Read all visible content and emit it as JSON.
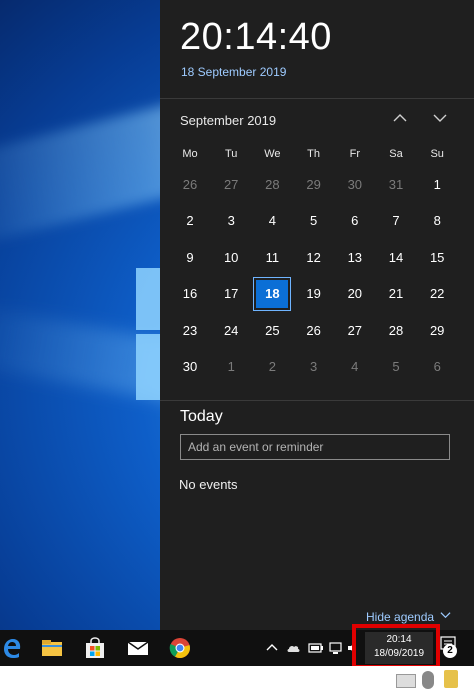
{
  "clock": {
    "time": "20:14:40",
    "date": "18 September 2019"
  },
  "calendar": {
    "month_label": "September 2019",
    "weekdays": [
      "Mo",
      "Tu",
      "We",
      "Th",
      "Fr",
      "Sa",
      "Su"
    ],
    "weeks": [
      [
        {
          "d": "26",
          "muted": true
        },
        {
          "d": "27",
          "muted": true
        },
        {
          "d": "28",
          "muted": true
        },
        {
          "d": "29",
          "muted": true
        },
        {
          "d": "30",
          "muted": true
        },
        {
          "d": "31",
          "muted": true
        },
        {
          "d": "1",
          "muted": false
        }
      ],
      [
        {
          "d": "2",
          "muted": false
        },
        {
          "d": "3",
          "muted": false
        },
        {
          "d": "4",
          "muted": false
        },
        {
          "d": "5",
          "muted": false
        },
        {
          "d": "6",
          "muted": false
        },
        {
          "d": "7",
          "muted": false
        },
        {
          "d": "8",
          "muted": false
        }
      ],
      [
        {
          "d": "9",
          "muted": false
        },
        {
          "d": "10",
          "muted": false
        },
        {
          "d": "11",
          "muted": false
        },
        {
          "d": "12",
          "muted": false
        },
        {
          "d": "13",
          "muted": false
        },
        {
          "d": "14",
          "muted": false
        },
        {
          "d": "15",
          "muted": false
        }
      ],
      [
        {
          "d": "16",
          "muted": false
        },
        {
          "d": "17",
          "muted": false
        },
        {
          "d": "18",
          "muted": false,
          "today": true
        },
        {
          "d": "19",
          "muted": false
        },
        {
          "d": "20",
          "muted": false
        },
        {
          "d": "21",
          "muted": false
        },
        {
          "d": "22",
          "muted": false
        }
      ],
      [
        {
          "d": "23",
          "muted": false
        },
        {
          "d": "24",
          "muted": false
        },
        {
          "d": "25",
          "muted": false
        },
        {
          "d": "26",
          "muted": false
        },
        {
          "d": "27",
          "muted": false
        },
        {
          "d": "28",
          "muted": false
        },
        {
          "d": "29",
          "muted": false
        }
      ],
      [
        {
          "d": "30",
          "muted": false
        },
        {
          "d": "1",
          "muted": true
        },
        {
          "d": "2",
          "muted": true
        },
        {
          "d": "3",
          "muted": true
        },
        {
          "d": "4",
          "muted": true
        },
        {
          "d": "5",
          "muted": true
        },
        {
          "d": "6",
          "muted": true
        }
      ]
    ],
    "prev_icon": "chevron-up-icon",
    "next_icon": "chevron-down-icon"
  },
  "agenda": {
    "heading": "Today",
    "input_placeholder": "Add an event or reminder",
    "empty_text": "No events",
    "hide_label": "Hide agenda"
  },
  "taskbar": {
    "pinned": [
      "edge-icon",
      "file-explorer-icon",
      "store-icon",
      "mail-icon",
      "chrome-icon"
    ],
    "tray": [
      "show-hidden-icons-chevron",
      "onedrive-icon",
      "battery-icon",
      "network-icon",
      "volume-icon"
    ],
    "clock_time": "20:14",
    "clock_date": "18/09/2019",
    "notification_count": "2"
  },
  "colors": {
    "accent": "#0b6fd6",
    "flyout_bg": "#1f1f1f",
    "highlight": "#e00000",
    "link": "#9ecbff"
  }
}
